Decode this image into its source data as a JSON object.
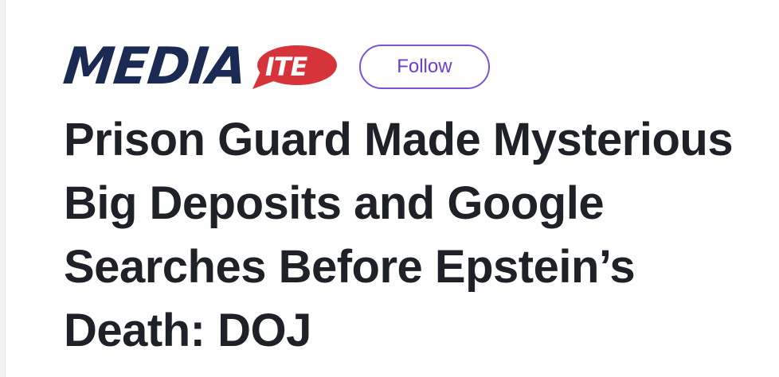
{
  "brand": {
    "part1": "MEDIA",
    "part2": "ITE",
    "primary_color": "#1b2a52",
    "accent_color": "#d6343a"
  },
  "follow": {
    "label": "Follow",
    "color": "#6a3fd2"
  },
  "headline": {
    "text": "Prison Guard Made Mysterious Big Deposits and Google Searches Before Epstein’s Death: DOJ",
    "color": "#1e2128"
  }
}
